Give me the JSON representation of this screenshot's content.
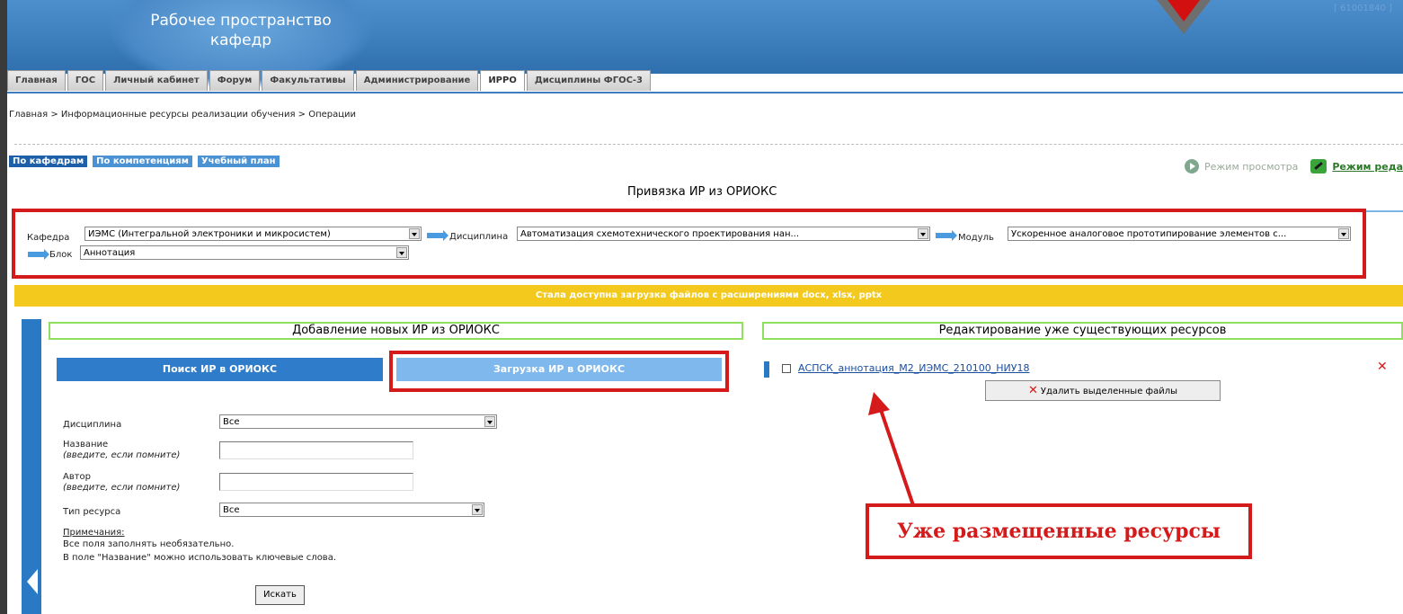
{
  "header": {
    "title_line1": "Рабочее пространство",
    "title_line2": "кафедр",
    "user_id": "[ 61001840 ]"
  },
  "tabs": [
    {
      "label": "Главная"
    },
    {
      "label": "ГОС"
    },
    {
      "label": "Личный кабинет"
    },
    {
      "label": "Форум"
    },
    {
      "label": "Факультативы"
    },
    {
      "label": "Администрирование"
    },
    {
      "label": "ИРРО",
      "active": true
    },
    {
      "label": "Дисциплины ФГОС-3"
    }
  ],
  "breadcrumb": "Главная > Информационные ресурсы реализации обучения > Операции",
  "filter_tabs": [
    "По кафедрам",
    "По компетенциям",
    "Учебный план"
  ],
  "modes": {
    "view": "Режим просмотра",
    "edit": "Режим реда"
  },
  "main_title": "Привязка ИР из ОРИОКС",
  "filters": {
    "kafedra_label": "Кафедра",
    "kafedra_value": "ИЭМС (Интегральной электроники и микросистем)",
    "discipline_label": "Дисциплина",
    "discipline_value": "Автоматизация схемотехнического проектирования нан...",
    "module_label": "Модуль",
    "module_value": "Ускоренное аналоговое прототипирование элементов с...",
    "block_label": "Блок",
    "block_value": "Аннотация"
  },
  "notice": "Стала доступна загрузка файлов с расширениями docx, xlsx, pptx",
  "left_panel": {
    "title": "Добавление новых ИР из ОРИОКС",
    "search_tab": "Поиск ИР в ОРИОКС",
    "upload_tab": "Загрузка ИР в ОРИОКС",
    "discipline_label": "Дисциплина",
    "discipline_value": "Все",
    "name_label": "Название",
    "name_hint": "(введите, если помните)",
    "author_label": "Автор",
    "author_hint": "(введите, если помните)",
    "type_label": "Тип ресурса",
    "type_value": "Все",
    "notes_title": "Примечания:",
    "note1": "Все поля заполнять необязательно.",
    "note2": "В поле \"Название\" можно использовать ключевые слова.",
    "search_button": "Искать"
  },
  "right_panel": {
    "title": "Редактирование уже существующих ресурсов",
    "resources": [
      {
        "name": "АСПСК_аннотация_М2_ИЭМС_210100_НИУ18"
      }
    ],
    "delete_selected": "Удалить выделенные файлы"
  },
  "annotation": "Уже размещенные ресурсы",
  "colors": {
    "accent_blue": "#2a79c5",
    "highlight_red": "#d41a1a",
    "notice_yellow": "#f2c91c",
    "panel_green": "#8ee05e"
  }
}
